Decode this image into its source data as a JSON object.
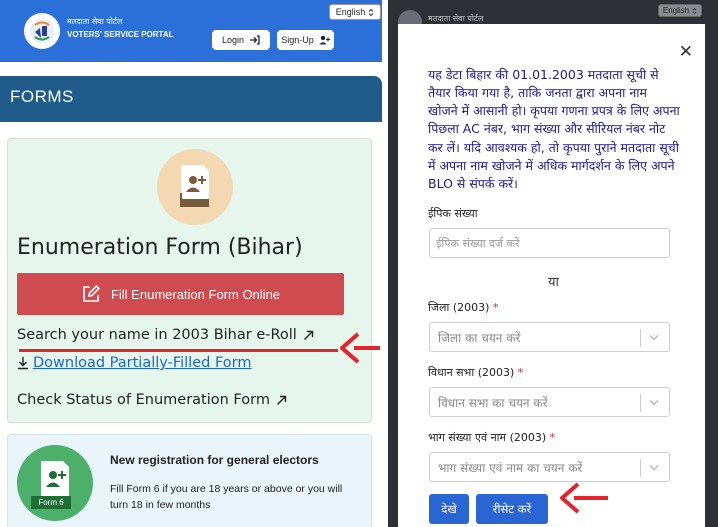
{
  "header": {
    "portal_name_hi": "मतदाता सेवा पोर्टल",
    "portal_name_en": "VOTERS' SERVICE PORTAL",
    "language": "English",
    "login_label": "Login",
    "signup_label": "Sign-Up"
  },
  "forms_bar": {
    "title": "FORMS"
  },
  "enumeration_card": {
    "title": "Enumeration Form (Bihar)",
    "fill_button": "Fill Enumeration Form Online",
    "search_link": "Search your name in 2003 Bihar e-Roll",
    "download_link": "Download Partially-Filled Form",
    "status_link": "Check Status of Enumeration Form"
  },
  "registration_card": {
    "badge": "Form 6",
    "title": "New registration for general electors",
    "description": "Fill Form 6 if you are 18 years or above or you will turn 18 in few months"
  },
  "right_panel": {
    "portal_name_hi": "मतदाता सेवा पोर्टल",
    "language": "English"
  },
  "modal": {
    "note": "यह डेटा बिहार की 01.01.2003 मतदाता सूची से तैयार किया गया है, ताकि जनता द्वारा अपना नाम खोजने में आसानी हो। कृपया गणना प्रपत्र के लिए अपना पिछला AC नंबर, भाग संख्या और सीरियल नंबर नोट कर लें। यदि आवश्यक हो, तो कृपया पुराने मतदाता सूची में अपना नाम खोजने में अधिक मार्गदर्शन के लिए अपने BLO से संपर्क करें।",
    "epic_label": "ईपिक संख्या",
    "epic_placeholder": "ईपिक संख्या दर्ज करें",
    "or_text": "या",
    "district_label": "जिला (2003)",
    "district_placeholder": "जिला का चयन करें",
    "assembly_label": "विधान सभा (2003)",
    "assembly_placeholder": "विधान सभा का चयन करें",
    "part_label": "भाग संख्या एवं नाम (2003)",
    "part_placeholder": "भाग संख्या एवं नाम का चयन करें",
    "required_mark": "*",
    "search_button": "देखे",
    "reset_button": "रीसेट करें"
  },
  "colors": {
    "header_blue": "#2b6fd8",
    "forms_bar": "#1f5c8a",
    "fill_button": "#d04b50",
    "annotation_red": "#e5232a",
    "link_blue": "#1a66d0",
    "modal_text": "#1d1b8c",
    "button_blue": "#2a65d4"
  }
}
